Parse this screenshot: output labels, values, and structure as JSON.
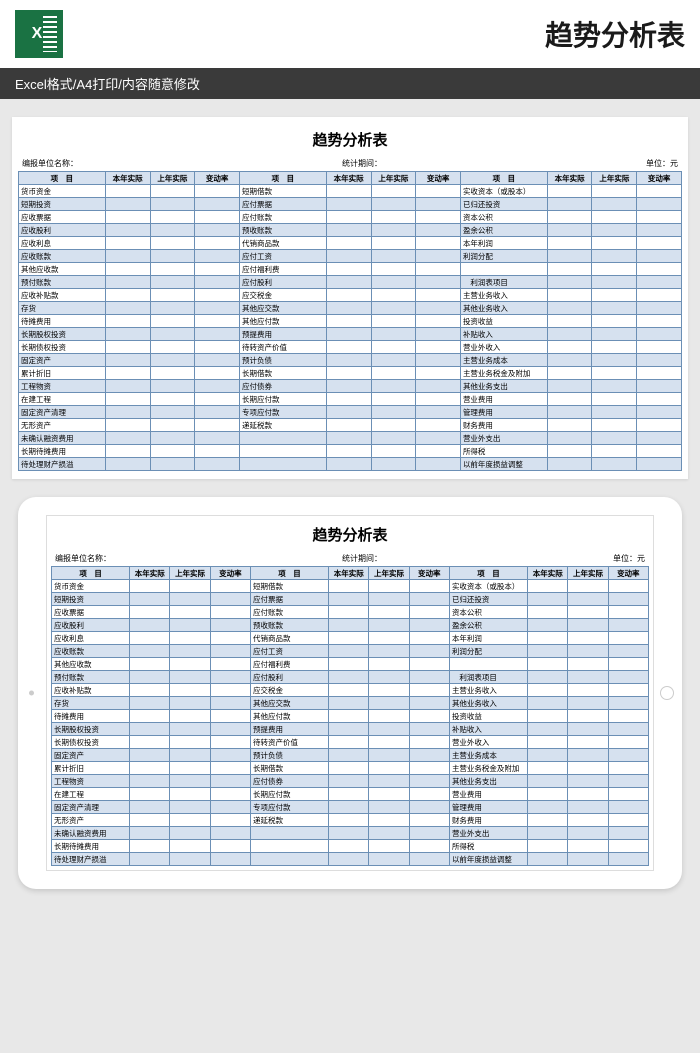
{
  "banner": {
    "title": "趋势分析表",
    "subtitle": "Excel格式/A4打印/内容随意修改",
    "icon_label": "X"
  },
  "sheet": {
    "title": "趋势分析表",
    "meta_left": "编报单位名称：",
    "meta_center": "统计期间：",
    "meta_right": "单位：元",
    "headers": [
      "项　目",
      "本年实际",
      "上年实际",
      "变动率",
      "项　目",
      "本年实际",
      "上年实际",
      "变动率",
      "项　目",
      "本年实际",
      "上年实际",
      "变动率"
    ],
    "rows": [
      [
        "货币资金",
        "",
        "",
        "",
        "短期借款",
        "",
        "",
        "",
        "实收资本（或股本）",
        "",
        "",
        ""
      ],
      [
        "短期投资",
        "",
        "",
        "",
        "应付票据",
        "",
        "",
        "",
        "已归还投资",
        "",
        "",
        ""
      ],
      [
        "应收票据",
        "",
        "",
        "",
        "应付账款",
        "",
        "",
        "",
        "资本公积",
        "",
        "",
        ""
      ],
      [
        "应收股利",
        "",
        "",
        "",
        "预收账款",
        "",
        "",
        "",
        "盈余公积",
        "",
        "",
        ""
      ],
      [
        "应收利息",
        "",
        "",
        "",
        "代销商品款",
        "",
        "",
        "",
        "本年利润",
        "",
        "",
        ""
      ],
      [
        "应收账款",
        "",
        "",
        "",
        "应付工资",
        "",
        "",
        "",
        "利润分配",
        "",
        "",
        ""
      ],
      [
        "其他应收款",
        "",
        "",
        "",
        "应付福利费",
        "",
        "",
        "",
        "",
        "",
        "",
        ""
      ],
      [
        "预付账款",
        "",
        "",
        "",
        "应付股利",
        "",
        "",
        "",
        "　利润表项目",
        "",
        "",
        ""
      ],
      [
        "应收补贴款",
        "",
        "",
        "",
        "应交税金",
        "",
        "",
        "",
        "主营业务收入",
        "",
        "",
        ""
      ],
      [
        "存货",
        "",
        "",
        "",
        "其他应交款",
        "",
        "",
        "",
        "其他业务收入",
        "",
        "",
        ""
      ],
      [
        "待摊费用",
        "",
        "",
        "",
        "其他应付款",
        "",
        "",
        "",
        "投资收益",
        "",
        "",
        ""
      ],
      [
        "长期股权投资",
        "",
        "",
        "",
        "预提费用",
        "",
        "",
        "",
        "补贴收入",
        "",
        "",
        ""
      ],
      [
        "长期债权投资",
        "",
        "",
        "",
        "待转资产价值",
        "",
        "",
        "",
        "营业外收入",
        "",
        "",
        ""
      ],
      [
        "固定资产",
        "",
        "",
        "",
        "预计负债",
        "",
        "",
        "",
        "主营业务成本",
        "",
        "",
        ""
      ],
      [
        "累计折旧",
        "",
        "",
        "",
        "长期借款",
        "",
        "",
        "",
        "主营业务税金及附加",
        "",
        "",
        ""
      ],
      [
        "工程物资",
        "",
        "",
        "",
        "应付债券",
        "",
        "",
        "",
        "其他业务支出",
        "",
        "",
        ""
      ],
      [
        "在建工程",
        "",
        "",
        "",
        "长期应付款",
        "",
        "",
        "",
        "营业费用",
        "",
        "",
        ""
      ],
      [
        "固定资产清理",
        "",
        "",
        "",
        "专项应付款",
        "",
        "",
        "",
        "管理费用",
        "",
        "",
        ""
      ],
      [
        "无形资产",
        "",
        "",
        "",
        "递延税款",
        "",
        "",
        "",
        "财务费用",
        "",
        "",
        ""
      ],
      [
        "未确认融资费用",
        "",
        "",
        "",
        "",
        "",
        "",
        "",
        "营业外支出",
        "",
        "",
        ""
      ],
      [
        "长期待摊费用",
        "",
        "",
        "",
        "",
        "",
        "",
        "",
        "所得税",
        "",
        "",
        ""
      ],
      [
        "待处理财产损溢",
        "",
        "",
        "",
        "",
        "",
        "",
        "",
        "以前年度损益调整",
        "",
        "",
        ""
      ]
    ]
  }
}
